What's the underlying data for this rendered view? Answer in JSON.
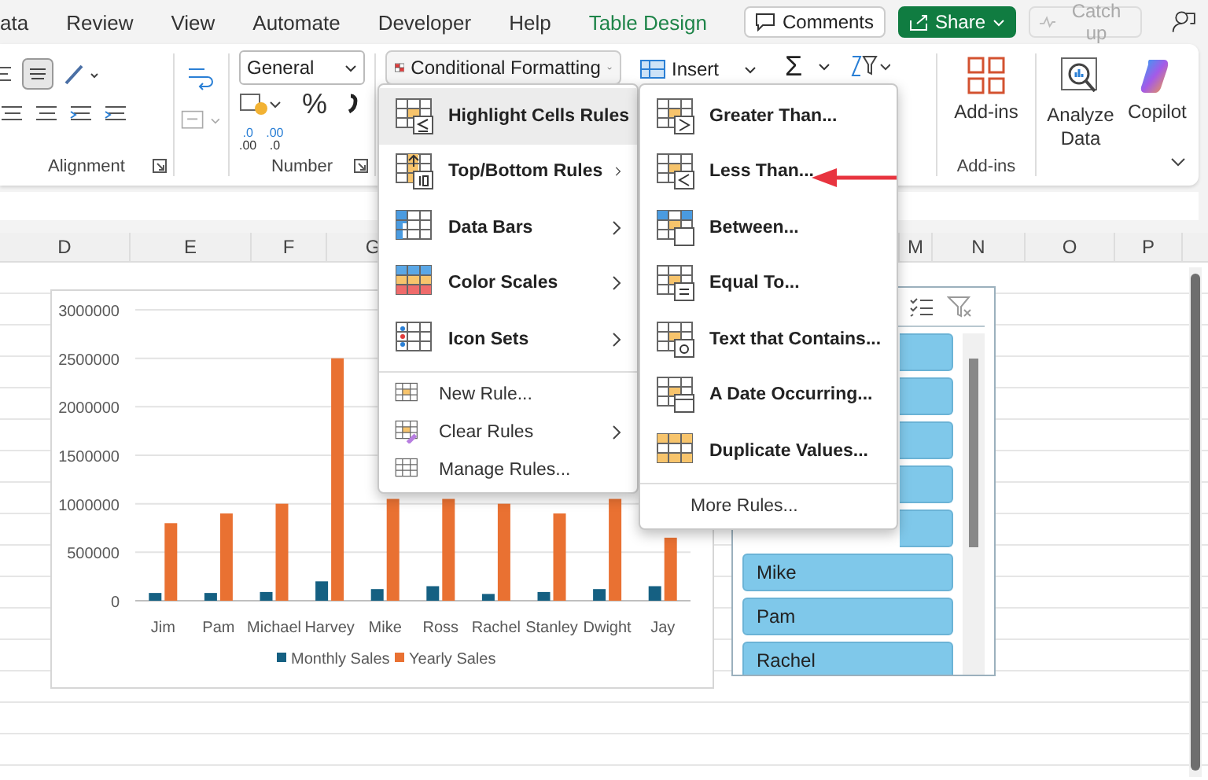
{
  "ribbon_tabs": [
    {
      "label": "ata",
      "kind": "normal"
    },
    {
      "label": "Review",
      "kind": "normal"
    },
    {
      "label": "View",
      "kind": "normal"
    },
    {
      "label": "Automate",
      "kind": "normal"
    },
    {
      "label": "Developer",
      "kind": "normal"
    },
    {
      "label": "Help",
      "kind": "normal"
    },
    {
      "label": "Table Design",
      "kind": "contextual"
    }
  ],
  "top_buttons": [
    {
      "kind": "comments",
      "label": "Comments",
      "disabled": false
    },
    {
      "kind": "share",
      "label": "Share",
      "disabled": false
    },
    {
      "kind": "catchup",
      "label": "Catch up",
      "disabled": true
    }
  ],
  "ribbon": {
    "number_format": "General",
    "percent": "%",
    "decimal_buttons": [
      {
        "top": ".0",
        "bottom": ".00"
      },
      {
        "top": ".00",
        "bottom": ".0"
      }
    ],
    "conditional_formatting": "Conditional Formatting",
    "insert": "Insert",
    "sum": "Σ",
    "addins_button": "Add-ins",
    "analyze_button": "Analyze Data",
    "copilot_button": "Copilot",
    "group_labels": [
      "Alignment",
      "Number",
      "Add-ins"
    ]
  },
  "sheet": {
    "column_headers_left": [
      "D",
      "E",
      "F",
      "G"
    ],
    "column_headers_right": [
      "M",
      "N",
      "O",
      "P"
    ]
  },
  "chart": {
    "chart_data": {
      "type": "bar",
      "categories": [
        "Jim",
        "Pam",
        "Michael",
        "Harvey",
        "Mike",
        "Ross",
        "Rachel",
        "Stanley",
        "Dwight",
        "Jay"
      ],
      "series": [
        {
          "name": "Monthly Sales",
          "color": "#156082",
          "values": [
            80000,
            80000,
            90000,
            200000,
            120000,
            150000,
            70000,
            90000,
            120000,
            150000
          ]
        },
        {
          "name": "Yearly Sales",
          "color": "#e97132",
          "values": [
            800000,
            900000,
            1000000,
            2500000,
            1050000,
            1050000,
            1000000,
            900000,
            1050000,
            650000
          ]
        }
      ],
      "ylim": [
        0,
        3000000
      ],
      "yticks": [
        0,
        500000,
        1000000,
        1500000,
        2000000,
        2500000,
        3000000
      ],
      "grid": true,
      "legend": true
    }
  },
  "slicer": {
    "items": [
      {
        "kind": "covered",
        "selected": true
      },
      {
        "kind": "covered",
        "selected": true
      },
      {
        "kind": "covered",
        "selected": true
      },
      {
        "kind": "covered",
        "selected": true
      },
      {
        "kind": "covered",
        "selected": true
      },
      {
        "kind": "item",
        "label": "Mike",
        "selected": true
      },
      {
        "kind": "item",
        "label": "Pam",
        "selected": true
      },
      {
        "kind": "item",
        "label": "Rachel",
        "selected": true
      }
    ]
  },
  "menu": {
    "items": [
      {
        "label": "Highlight Cells Rules",
        "kind": "large",
        "submenu": true,
        "selected": true
      },
      {
        "label": "Top/Bottom Rules",
        "kind": "large",
        "submenu": true,
        "selected": false
      },
      {
        "label": "Data Bars",
        "kind": "large",
        "submenu": true,
        "selected": false
      },
      {
        "label": "Color Scales",
        "kind": "large",
        "submenu": true,
        "selected": false
      },
      {
        "label": "Icon Sets",
        "kind": "large",
        "submenu": true,
        "selected": false
      },
      {
        "label": "New Rule...",
        "kind": "small",
        "submenu": false,
        "selected": false
      },
      {
        "label": "Clear Rules",
        "kind": "small",
        "submenu": true,
        "selected": false
      },
      {
        "label": "Manage Rules...",
        "kind": "small",
        "submenu": false,
        "selected": false
      }
    ]
  },
  "submenu": {
    "items": [
      {
        "label": "Greater Than..."
      },
      {
        "label": "Less Than..."
      },
      {
        "label": "Between..."
      },
      {
        "label": "Equal To..."
      },
      {
        "label": "Text that Contains..."
      },
      {
        "label": "A Date Occurring..."
      },
      {
        "label": "Duplicate Values..."
      }
    ],
    "footer": "More Rules..."
  },
  "arrow_annotation": true
}
